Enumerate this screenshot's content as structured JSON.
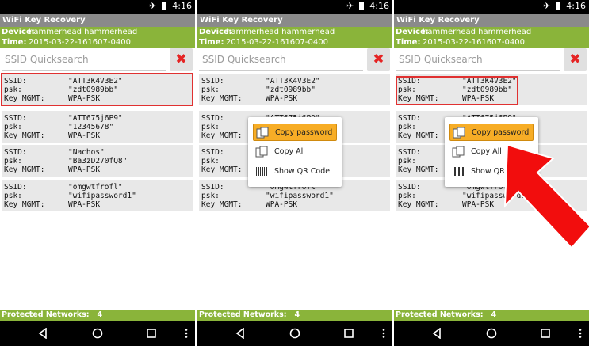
{
  "status": {
    "time": "4:16"
  },
  "app": {
    "title": "WiFi Key Recovery"
  },
  "device": {
    "label": "Device:",
    "value": "hammerhead hammerhead"
  },
  "time_row": {
    "label": "Time:",
    "value": "2015-03-22-161607-0400"
  },
  "search": {
    "placeholder": "SSID Quicksearch"
  },
  "labels": {
    "ssid": "SSID:",
    "psk": "psk:",
    "mgmt": "Key MGMT:"
  },
  "networks": [
    {
      "ssid": "\"ATT3K4V3E2\"",
      "psk": "\"zdt0989bb\"",
      "mgmt": "WPA-PSK"
    },
    {
      "ssid": "\"ATT675j6P9\"",
      "psk": "\"12345678\"",
      "mgmt": "WPA-PSK"
    },
    {
      "ssid": "\"Nachos\"",
      "psk": "\"Ba3zD270fQ8\"",
      "mgmt": "WPA-PSK"
    },
    {
      "ssid": "\"omgwtfrofl\"",
      "psk": "\"wifipassword1\"",
      "mgmt": "WPA-PSK"
    }
  ],
  "menu": {
    "copy_password": "Copy password",
    "copy_all": "Copy All",
    "show_qr": "Show QR Code"
  },
  "footer": {
    "label": "Protected Networks:",
    "count": "4"
  },
  "icons": {
    "airplane": "airplane-icon",
    "battery": "battery-icon",
    "clear": "clear-icon",
    "back": "back-icon",
    "home": "home-icon",
    "recents": "recents-icon",
    "more": "more-icon"
  },
  "colors": {
    "green": "#8ab43a",
    "highlight": "#e03131",
    "menu_active": "#f7ad26"
  }
}
